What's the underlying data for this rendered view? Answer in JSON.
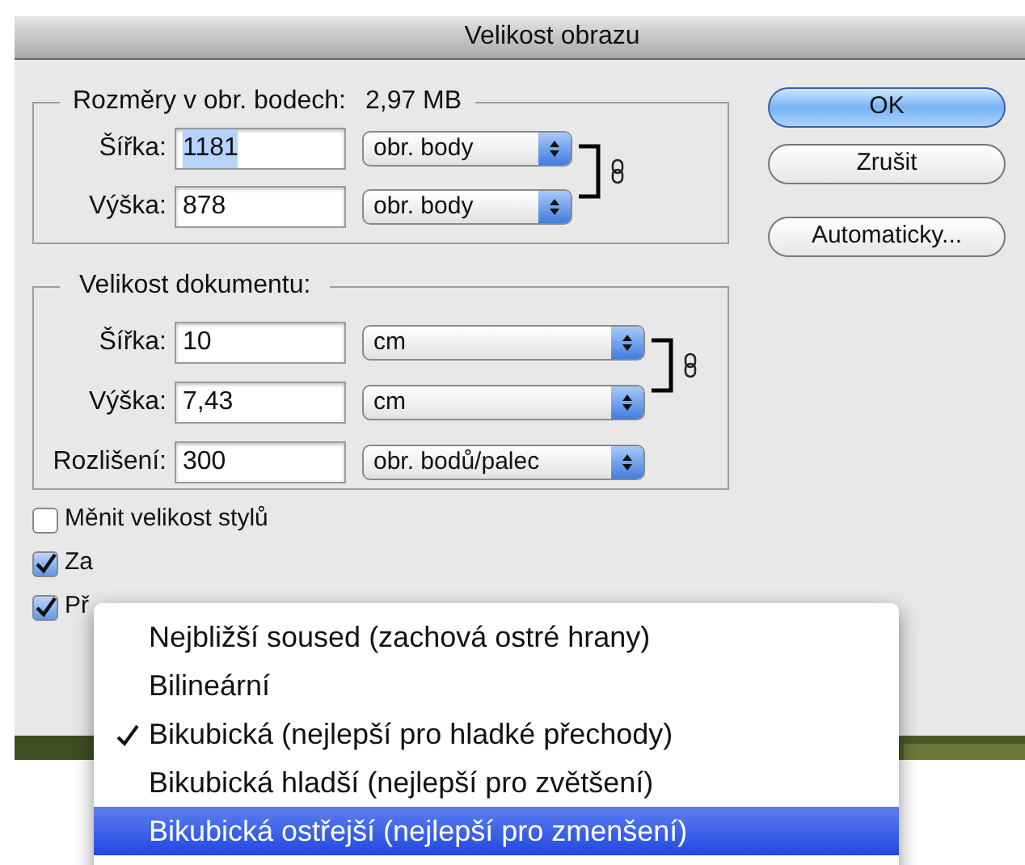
{
  "window": {
    "title": "Velikost obrazu"
  },
  "pixel_dimensions": {
    "legend": "Rozměry v obr. bodech:",
    "size": "2,97 MB",
    "rows": [
      {
        "label": "Šířka:",
        "value": "1181",
        "unit": "obr. body",
        "selected": true
      },
      {
        "label": "Výška:",
        "value": "878",
        "unit": "obr. body",
        "selected": false
      }
    ]
  },
  "document_size": {
    "legend": "Velikost dokumentu:",
    "rows": [
      {
        "label": "Šířka:",
        "value": "10",
        "unit": "cm"
      },
      {
        "label": "Výška:",
        "value": "7,43",
        "unit": "cm"
      },
      {
        "label": "Rozlišení:",
        "value": "300",
        "unit": "obr. bodů/palec"
      }
    ]
  },
  "buttons": [
    {
      "label": "OK",
      "default": true
    },
    {
      "label": "Zrušit",
      "default": false
    },
    {
      "label": "Automaticky...",
      "default": false
    }
  ],
  "checkboxes": [
    {
      "label": "Měnit velikost stylů",
      "checked": false
    },
    {
      "label": "Za",
      "checked": true
    },
    {
      "label": "Př",
      "checked": true
    }
  ],
  "menu": {
    "items": [
      {
        "label": "Nejbližší soused (zachová ostré hrany)",
        "checked": false,
        "selected": false
      },
      {
        "label": "Bilineární",
        "checked": false,
        "selected": false
      },
      {
        "label": "Bikubická (nejlepší pro hladké přechody)",
        "checked": true,
        "selected": false
      },
      {
        "label": "Bikubická hladší (nejlepší pro zvětšení)",
        "checked": false,
        "selected": false
      },
      {
        "label": "Bikubická ostřejší (nejlepší pro zmenšení)",
        "checked": false,
        "selected": true
      }
    ]
  }
}
